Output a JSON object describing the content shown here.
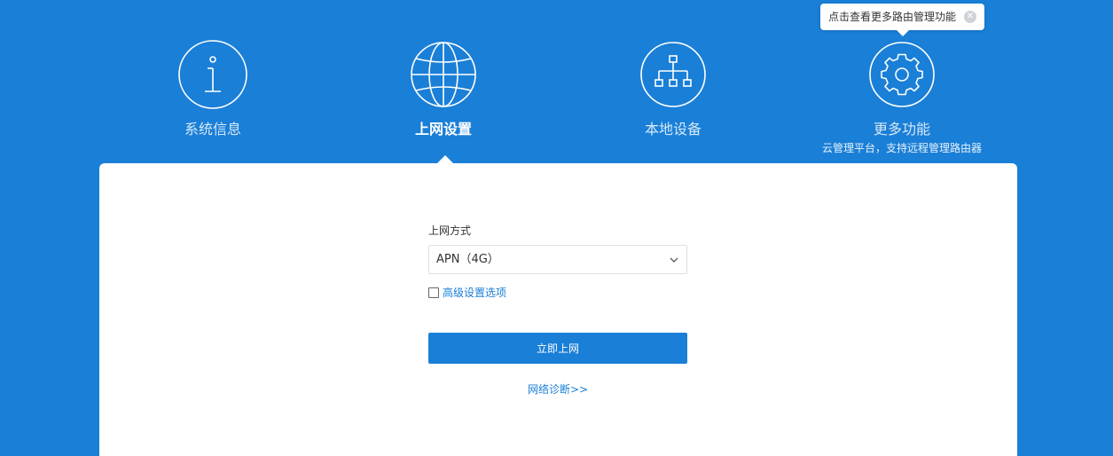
{
  "nav": {
    "items": [
      {
        "label": "系统信息",
        "icon": "info-icon"
      },
      {
        "label": "上网设置",
        "icon": "globe-icon",
        "active": true
      },
      {
        "label": "本地设备",
        "icon": "network-topology-icon"
      },
      {
        "label": "更多功能",
        "icon": "gear-icon",
        "sub": "云管理平台，支持远程管理路由器"
      }
    ]
  },
  "tooltip": {
    "text": "点击查看更多路由管理功能",
    "close_icon": "close-circle-icon"
  },
  "form": {
    "method_label": "上网方式",
    "method_value": "APN（4G）",
    "advanced_label": "高级设置选项",
    "submit_label": "立即上网",
    "diagnose_link": "网络诊断>>"
  },
  "colors": {
    "brand": "#1a7fd7",
    "card": "#ffffff",
    "text": "#333333"
  }
}
